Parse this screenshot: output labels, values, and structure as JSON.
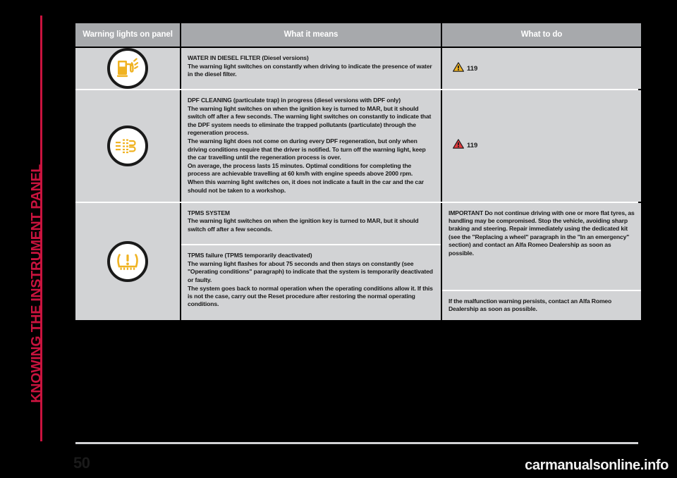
{
  "document": {
    "chapter_title": "KNOWING THE INSTRUMENT PANEL",
    "page_number": "50",
    "watermark": "carmanualsonline.info",
    "accent_color": "#c9133e",
    "header_bg": "#a7a9ac",
    "cell_bg": "#d2d3d5"
  },
  "table": {
    "headers": {
      "col1": "Warning lights on panel",
      "col2": "What it means",
      "col3": "What to do"
    },
    "rows": [
      {
        "icon": "fuel-pump-water-icon",
        "icon_color": "#f0b323",
        "means": {
          "title": "WATER IN DIESEL FILTER (Diesel versions)",
          "paragraphs": [
            "The warning light switches on constantly when driving to indicate the presence of water in the diesel filter."
          ]
        },
        "todo": {
          "type": "reference",
          "symbol": "warning-triangle-yellow-icon",
          "symbol_color": "#f0b323",
          "reference": "119"
        }
      },
      {
        "icon": "dpf-particulate-filter-icon",
        "icon_color": "#f0b323",
        "means": {
          "title": "DPF CLEANING (particulate trap) in progress (diesel versions with DPF only)",
          "paragraphs": [
            "The warning light switches on when the ignition key is turned to MAR, but it should switch off after a few seconds. The warning light switches on constantly to indicate that the DPF system needs to eliminate the trapped pollutants (particulate) through the regeneration process.",
            "The warning light does not come on during every DPF regeneration, but only when driving conditions require that the driver is notified. To turn off the warning light, keep the car travelling until the regeneration process is over.",
            "On average, the process lasts 15 minutes. Optimal conditions for completing the process are achievable travelling at 60 km/h with engine speeds above 2000 rpm.",
            "When this warning light switches on, it does not indicate a fault in the car and the car should not be taken to a workshop."
          ]
        },
        "todo": {
          "type": "reference",
          "symbol": "warning-triangle-red-icon",
          "symbol_color": "#e03a3e",
          "reference": "119"
        }
      },
      {
        "icon": "tpms-tire-pressure-icon",
        "icon_color": "#f0b323",
        "means": {
          "title": "TPMS SYSTEM",
          "paragraphs": [
            "The warning light switches on when the ignition key is turned to MAR, but it should switch off after a few seconds."
          ]
        },
        "todo": {
          "type": "text",
          "paragraphs": [
            "IMPORTANT Do not continue driving with one or more flat tyres, as handling may be compromised. Stop the vehicle, avoiding sharp braking and steering. Repair immediately using the dedicated kit (see the \"Replacing a wheel\" paragraph in the \"In an emergency\" section) and contact an Alfa Romeo Dealership as soon as possible."
          ]
        }
      },
      {
        "icon": null,
        "means": {
          "title": "TPMS failure (TPMS temporarily deactivated)",
          "paragraphs": [
            "The warning light flashes for about 75 seconds and then stays on constantly (see \"Operating conditions\" paragraph) to indicate that the system is temporarily deactivated or faulty.",
            "The system goes back to normal operation when the operating conditions allow it. If this is not the case, carry out the Reset procedure after restoring the normal operating conditions."
          ]
        },
        "todo": {
          "type": "text",
          "paragraphs": [
            "If the malfunction warning persists, contact an Alfa Romeo Dealership as soon as possible."
          ]
        }
      }
    ]
  }
}
